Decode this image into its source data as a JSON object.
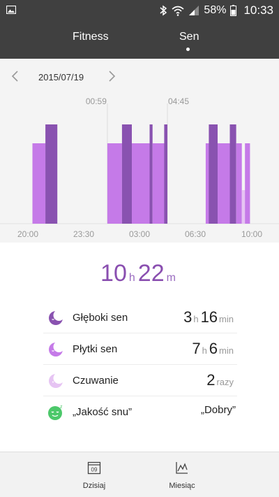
{
  "status_bar": {
    "battery": "58%",
    "time": "10:33"
  },
  "tabs": [
    {
      "label": "Fitness",
      "active": false
    },
    {
      "label": "Sen",
      "active": true
    }
  ],
  "date_nav": {
    "date": "2015/07/19"
  },
  "chart_data": {
    "type": "bar",
    "markers": [
      "00:59",
      "04:45"
    ],
    "x_tick_labels": [
      "20:00",
      "23:30",
      "03:00",
      "06:30",
      "10:00"
    ],
    "x_range": [
      "20:00",
      "10:00"
    ],
    "legend": [
      "Głęboki sen",
      "Płytki sen",
      "Czuwanie"
    ],
    "segments": [
      {
        "stage": "Płytki sen",
        "start": "20:17",
        "end": "21:06"
      },
      {
        "stage": "Głęboki sen",
        "start": "21:06",
        "end": "21:51"
      },
      {
        "stage": "Płytki sen",
        "start": "00:59",
        "end": "01:54"
      },
      {
        "stage": "Głęboki sen",
        "start": "01:54",
        "end": "02:31"
      },
      {
        "stage": "Płytki sen",
        "start": "02:31",
        "end": "03:38"
      },
      {
        "stage": "Głęboki sen",
        "start": "03:38",
        "end": "03:49"
      },
      {
        "stage": "Płytki sen",
        "start": "03:49",
        "end": "04:33"
      },
      {
        "stage": "Głęboki sen",
        "start": "04:33",
        "end": "04:45"
      },
      {
        "stage": "Płytki sen",
        "start": "07:09",
        "end": "07:21"
      },
      {
        "stage": "Głęboki sen",
        "start": "07:21",
        "end": "07:54"
      },
      {
        "stage": "Płytki sen",
        "start": "07:54",
        "end": "08:40"
      },
      {
        "stage": "Głęboki sen",
        "start": "08:40",
        "end": "09:04"
      },
      {
        "stage": "Płytki sen",
        "start": "09:04",
        "end": "09:25"
      },
      {
        "stage": "Czuwanie",
        "start": "09:25",
        "end": "09:37"
      },
      {
        "stage": "Płytki sen",
        "start": "09:37",
        "end": "09:56"
      }
    ],
    "colors": {
      "Głęboki sen": "#8952b0",
      "Płytki sen": "#c57ae8",
      "Czuwanie": "#e6c4f3"
    }
  },
  "summary": {
    "hours": "10",
    "hours_unit": "h",
    "minutes": "22",
    "minutes_unit": "m"
  },
  "stats": [
    {
      "label": "Głęboki sen",
      "icon": "deep-sleep-moon-icon",
      "h": "3",
      "h_unit": "h",
      "m": "16",
      "m_unit": "min"
    },
    {
      "label": "Płytki sen",
      "icon": "light-sleep-moon-icon",
      "h": "7",
      "h_unit": "h",
      "m": "6",
      "m_unit": "min"
    },
    {
      "label": "Czuwanie",
      "icon": "awake-moon-icon",
      "count": "2",
      "count_unit": "razy"
    },
    {
      "label": "„Jakość snu”",
      "icon": "sleep-quality-face-icon",
      "text": "„Dobry”"
    }
  ],
  "bottom_nav": [
    {
      "label": "Dzisiaj",
      "icon": "calendar-icon",
      "icon_text": "09"
    },
    {
      "label": "Miesiąc",
      "icon": "line-chart-icon"
    }
  ]
}
